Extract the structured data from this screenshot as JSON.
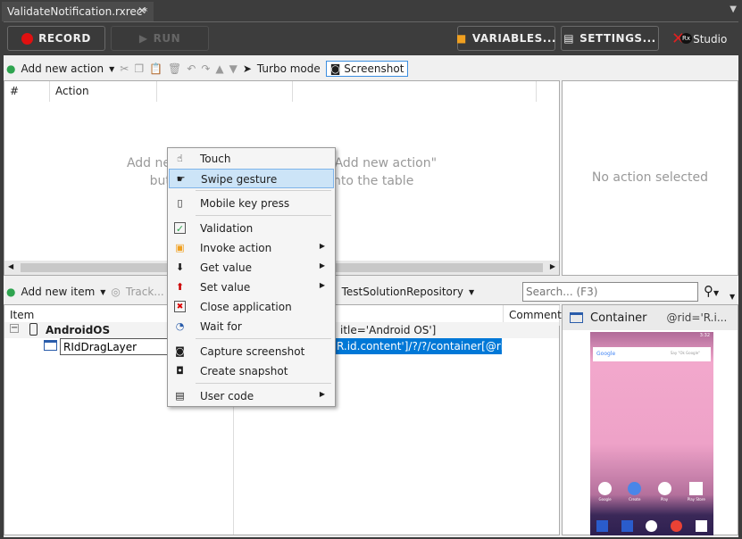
{
  "tab": {
    "title": "ValidateNotification.rxrec*",
    "close": "✕"
  },
  "main_toolbar": {
    "record": "RECORD",
    "run": "RUN",
    "variables": "VARIABLES...",
    "settings": "SETTINGS...",
    "logo": "Studio",
    "logo_badge": "Rx"
  },
  "action_toolbar": {
    "add_new_action": "Add new action",
    "turbo_mode": "Turbo mode",
    "screenshot": "Screenshot"
  },
  "action_table": {
    "columns": [
      "#",
      "Action"
    ],
    "empty_line1": "Add new actions by clicking the \"Add new action\"",
    "empty_line2": "button or by dragging items into the table"
  },
  "details_panel": {
    "empty": "No action selected"
  },
  "repo_toolbar": {
    "add_new_item": "Add new item",
    "track": "Track...",
    "repository": "TestSolutionRepository",
    "search_placeholder": "Search... (F3)"
  },
  "repo_tree": {
    "columns": [
      "Item",
      "Comment"
    ],
    "rows": [
      {
        "name": "AndroidOS",
        "path": "itle='Android OS']"
      },
      {
        "name": "RIdDragLayer",
        "path": "R.id.content']/?/?/container[@rid..."
      }
    ]
  },
  "preview": {
    "type": "Container",
    "rid": "@rid='R.i...",
    "search_widget": "Google",
    "search_hint": "Say \"Ok Google\"",
    "time": "3:32",
    "apps": [
      "Google",
      "Create",
      "Play",
      "Play Store"
    ]
  },
  "context_menu": {
    "items": [
      {
        "label": "Touch"
      },
      {
        "label": "Swipe gesture",
        "highlighted": true
      },
      {
        "label": "Mobile key press"
      },
      {
        "label": "Validation"
      },
      {
        "label": "Invoke action",
        "submenu": true
      },
      {
        "label": "Get value",
        "submenu": true
      },
      {
        "label": "Set value",
        "submenu": true
      },
      {
        "label": "Close application"
      },
      {
        "label": "Wait for"
      },
      {
        "label": "Capture screenshot"
      },
      {
        "label": "Create snapshot"
      },
      {
        "label": "User code",
        "submenu": true
      }
    ]
  },
  "colors": {
    "record": "#e01010",
    "selection": "#0078d7",
    "menu_highlight": "#cce4f7",
    "accent_green": "#2ea44f"
  }
}
